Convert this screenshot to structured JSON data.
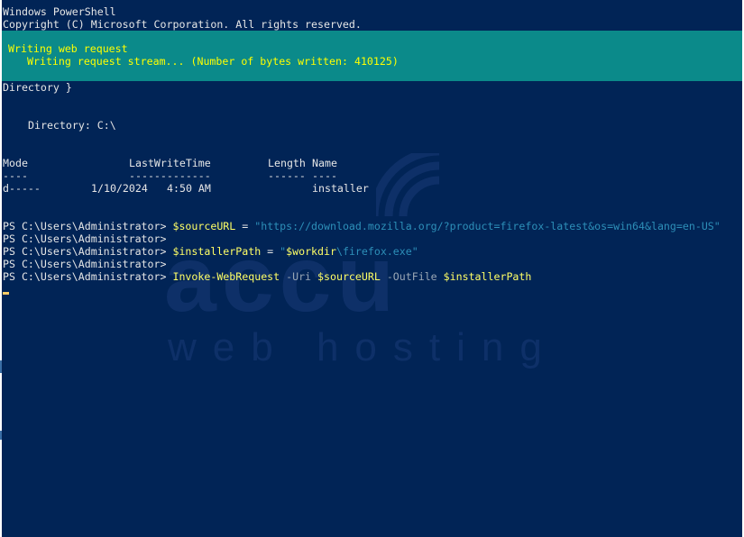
{
  "window": {
    "title": "Windows PowerShell",
    "copyright": "Copyright (C) Microsoft Corporation. All rights reserved."
  },
  "progress": {
    "activity": "Writing web request",
    "status": "Writing request stream... (Number of bytes written: 410125)"
  },
  "output": {
    "directory_close": "Directory }",
    "directory_label": "Directory: C:\\",
    "headers": {
      "mode": "Mode",
      "lastwrite": "LastWriteTime",
      "length": "Length",
      "name": "Name"
    },
    "underlines": {
      "mode": "----",
      "lastwrite": "-------------",
      "length": "------",
      "name": "----"
    },
    "row": {
      "mode": "d-----",
      "date": "1/10/2024",
      "time": "4:50 AM",
      "name": "installer"
    }
  },
  "prompt": "PS C:\\Users\\Administrator> ",
  "commands": [
    {
      "var": "$sourceURL",
      "eq": " = ",
      "string": "\"https://download.mozilla.org/?product=firefox-latest&os=win64&lang=en-US\""
    },
    {
      "empty": true
    },
    {
      "var": "$installerPath",
      "eq": " = ",
      "str_open": "\"",
      "str_var": "$workdir",
      "str_rest": "\\firefox.exe\""
    },
    {
      "empty": true
    },
    {
      "cmd": "Invoke-WebRequest",
      "p1": " -Uri ",
      "v1": "$sourceURL",
      "p2": " -OutFile ",
      "v2": "$installerPath"
    }
  ],
  "watermark": {
    "brand": "accu",
    "tagline": "web hosting"
  },
  "colors": {
    "background": "#012456",
    "progress_bg": "#0b8a8a",
    "progress_text": "#ffff00",
    "command": "#ffff66",
    "string": "#2d8fb8"
  }
}
